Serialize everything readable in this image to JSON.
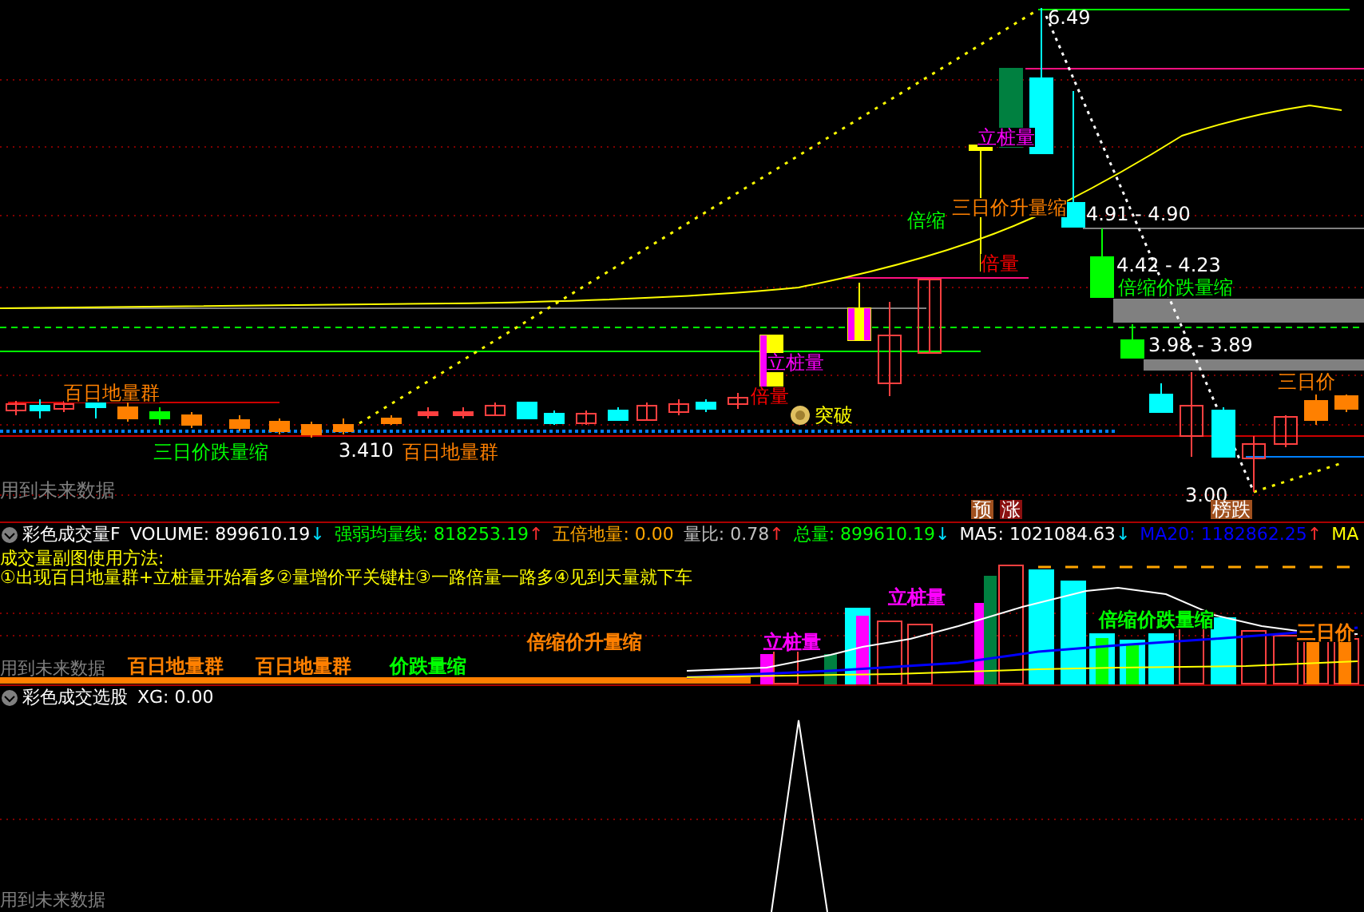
{
  "main_pane": {
    "price_labels": [
      {
        "text": "6.49"
      },
      {
        "text": "4.91 - 4.90"
      },
      {
        "text": "4.42 - 4.23"
      },
      {
        "text": "3.98 - 3.89"
      },
      {
        "text": "3.410"
      },
      {
        "text": "3.00"
      }
    ],
    "annotations": [
      {
        "text": "立桩量",
        "color": "#ff00ff"
      },
      {
        "text": "三日价升量缩",
        "color": "#ff8000"
      },
      {
        "text": "倍缩",
        "color": "#00ff00"
      },
      {
        "text": "倍量",
        "color": "#ff0000"
      },
      {
        "text": "倍缩价跌量缩",
        "color": "#00ff00"
      },
      {
        "text": "立桩量",
        "color": "#ff00ff"
      },
      {
        "text": "三日价",
        "color": "#ff8000"
      },
      {
        "text": "百日地量群",
        "color": "#ff8000"
      },
      {
        "text": "倍量",
        "color": "#ff0000"
      },
      {
        "text": "突破",
        "color": "#ffff00"
      },
      {
        "text": "三日价跌量缩",
        "color": "#00ff00"
      },
      {
        "text": "百日地量群",
        "color": "#ff8000"
      }
    ],
    "signals": [
      {
        "text": "预",
        "color": "#a0501e"
      },
      {
        "text": "涨",
        "color": "#8b1010"
      },
      {
        "text": "榜跌",
        "color": "#a0501e"
      }
    ],
    "footer": "用到未来数据"
  },
  "volume_pane": {
    "title": "彩色成交量F",
    "indicators": [
      {
        "label": "VOLUME:",
        "value": "899610.19",
        "arrow": "↓",
        "color": "#ffffff"
      },
      {
        "label": "强弱均量线:",
        "value": "818253.19",
        "arrow": "↑",
        "color": "#00ff00"
      },
      {
        "label": "五倍地量:",
        "value": "0.00",
        "color": "#ffa500"
      },
      {
        "label": "量比:",
        "value": "0.78",
        "arrow": "↑",
        "color": "#c0c0c0"
      },
      {
        "label": "总量:",
        "value": "899610.19",
        "arrow": "↓",
        "color": "#00ff00"
      },
      {
        "label": "MA5:",
        "value": "1021084.63",
        "arrow": "↓",
        "color": "#ffffff"
      },
      {
        "label": "MA20:",
        "value": "1182862.25",
        "arrow": "↑",
        "color": "#0000ff"
      },
      {
        "label": "MA",
        "color": "#ffff00"
      }
    ],
    "usage_title": "成交量副图使用方法:",
    "usage_text": "①出现百日地量群+立桩量开始看多②量增价平关键柱③一路倍量一路多④见到天量就下车",
    "annotations": [
      {
        "text": "立桩量",
        "color": "#ff00ff"
      },
      {
        "text": "倍缩价跌量缩",
        "color": "#00ff00"
      },
      {
        "text": "三日价",
        "color": "#ff8000"
      },
      {
        "text": "倍缩价升量缩",
        "color": "#ff8000"
      },
      {
        "text": "立桩量",
        "color": "#ff00ff"
      },
      {
        "text": "百日地量群",
        "color": "#ff8000"
      },
      {
        "text": "百日地量群",
        "color": "#ff8000"
      },
      {
        "text": "价跌量缩",
        "color": "#00ff00"
      }
    ],
    "footer": "用到未来数据"
  },
  "selector_pane": {
    "title": "彩色成交选股",
    "indicators": [
      {
        "label": "XG:",
        "value": "0.00"
      }
    ],
    "footer": "用到未来数据"
  }
}
